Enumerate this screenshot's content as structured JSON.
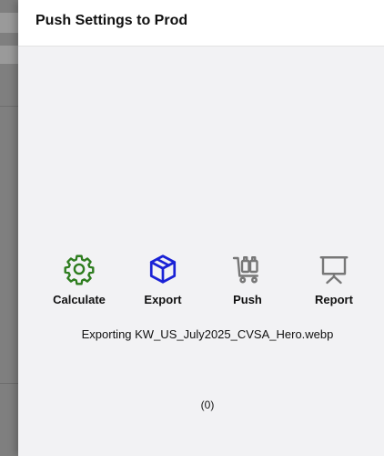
{
  "drawer": {
    "title": "Push Settings to Prod"
  },
  "actions": [
    {
      "label": "Calculate",
      "icon": "gear-icon",
      "color": "#2e7d1f"
    },
    {
      "label": "Export",
      "icon": "box-icon",
      "color": "#1a22d6"
    },
    {
      "label": "Push",
      "icon": "cart-icon",
      "color": "#777777"
    },
    {
      "label": "Report",
      "icon": "presentation-icon",
      "color": "#777777"
    }
  ],
  "status": {
    "message": "Exporting KW_US_July2025_CVSA_Hero.webp",
    "count": "(0)"
  }
}
